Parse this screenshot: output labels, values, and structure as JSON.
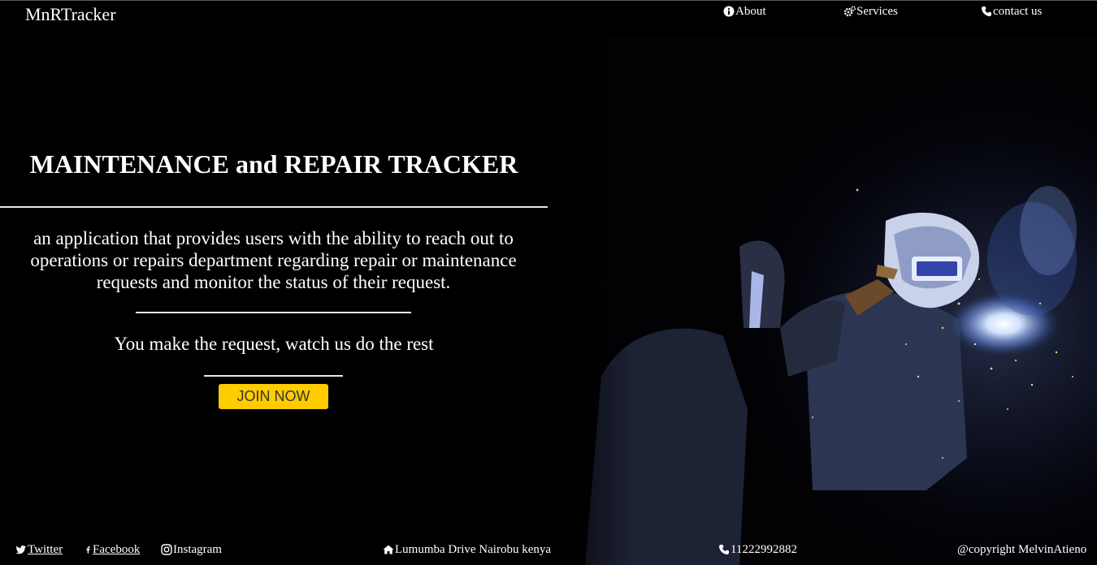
{
  "brand": "MnRTracker",
  "nav": {
    "about": "About",
    "services": "Services",
    "contact": "contact us"
  },
  "hero": {
    "title": "MAINTENANCE and REPAIR TRACKER",
    "description": "an application that provides users with the ability to reach out to operations or repairs department regarding repair or maintenance requests and monitor the status of their request.",
    "tagline": "You make the request, watch us do the rest",
    "cta": "JOIN NOW"
  },
  "footer": {
    "twitter": "Twitter",
    "facebook": "Facebook",
    "instagram": "Instagram",
    "address": "Lumumba Drive Nairobu kenya",
    "phone": "11222992882",
    "copyright": "@copyright MelvinAtieno"
  },
  "colors": {
    "background": "#000000",
    "accent": "#ffcc00",
    "text": "#ffffff"
  },
  "icons": {
    "about": "info-circle-icon",
    "services": "gears-icon",
    "contact": "phone-icon",
    "twitter": "twitter-icon",
    "facebook": "facebook-icon",
    "instagram": "instagram-icon",
    "address": "home-icon",
    "phone": "phone-icon"
  }
}
